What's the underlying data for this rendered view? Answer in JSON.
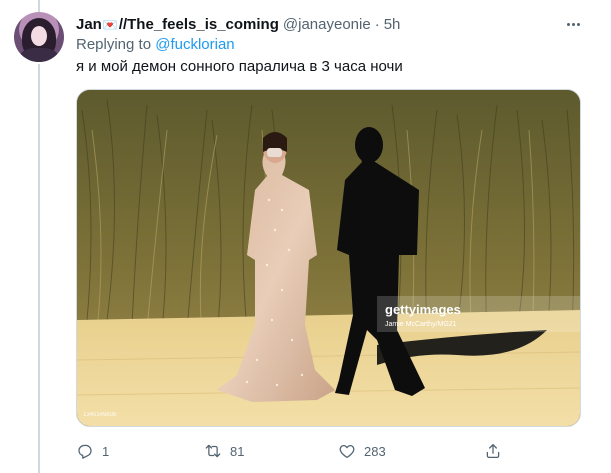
{
  "tweet": {
    "display_name": "Jan",
    "display_name_suffix": "//The_feels_is_coming",
    "badge_icon": "heart-emoji-icon",
    "handle": "@janayeonie",
    "separator": "·",
    "time": "5h",
    "replying_prefix": "Replying to ",
    "replying_to": "@fucklorian",
    "text": "я и мой демон сонного паралича в 3 часа ночи",
    "media": {
      "watermark_brand": "gettyimages",
      "watermark_credit": "Jamie McCarthy/MG21",
      "image_id": "1340149836"
    },
    "actions": {
      "reply_count": "1",
      "retweet_count": "81",
      "like_count": "283"
    }
  },
  "colors": {
    "accent": "#1d9bf0",
    "muted": "#536471",
    "text": "#0f1419",
    "border": "#cfd9de"
  }
}
